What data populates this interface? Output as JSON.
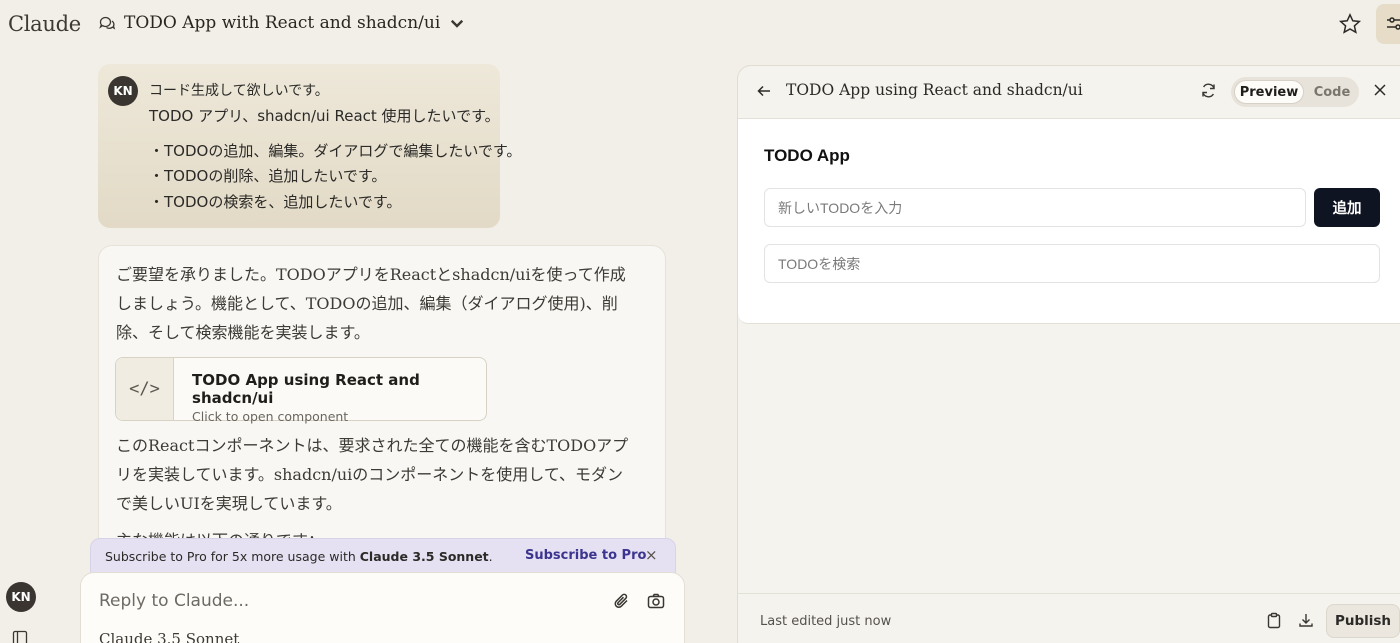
{
  "app": {
    "logo": "Claude"
  },
  "header": {
    "conversation_title": "TODO App with React and shadcn/ui"
  },
  "user_message": {
    "avatar": "KN",
    "lines": [
      "コード生成して欲しいです。",
      "TODO アプリ、shadcn/ui React 使用したいです。",
      "・TODOの追加、編集。ダイアログで編集したいです。",
      "・TODOの削除、追加したいです。",
      "・TODOの検索を、追加したいです。"
    ]
  },
  "assistant_message": {
    "para1": "ご要望を承りました。TODOアプリをReactとshadcn/uiを使って作成しましょう。機能として、TODOの追加、編集（ダイアログ使用)、削除、そして検索機能を実装します。",
    "artifact": {
      "icon": "</>",
      "title": "TODO App using React and shadcn/ui",
      "subtitle": "Click to open component"
    },
    "para2": "このReactコンポーネントは、要求された全ての機能を含むTODOアプリを実装しています。shadcn/uiのコンポーネントを使用して、モダンで美しいUIを実現しています。",
    "para3_partial": "主な機能は以下の通りです："
  },
  "banner": {
    "text_prefix": "Subscribe to Pro for 5x more usage with ",
    "text_bold": "Claude 3.5 Sonnet",
    "text_suffix": ".",
    "link": "Subscribe to Pro",
    "close": "×"
  },
  "reply": {
    "placeholder": "Reply to Claude...",
    "model": "Claude 3.5 Sonnet"
  },
  "sidebar": {
    "avatar": "KN"
  },
  "panel": {
    "title": "TODO App using React and shadcn/ui",
    "tab_preview": "Preview",
    "tab_code": "Code",
    "active_tab": "Preview",
    "footer_text": "Last edited just now",
    "publish_label": "Publish"
  },
  "todo_app": {
    "title": "TODO App",
    "new_placeholder": "新しいTODOを入力",
    "add_label": "追加",
    "search_placeholder": "TODOを検索"
  },
  "colors": {
    "background": "#f1efe8",
    "user_bubble": "#e2dac6",
    "banner": "#e6e1f2",
    "banner_link": "#3b3590",
    "primary_button": "#0f1422"
  }
}
